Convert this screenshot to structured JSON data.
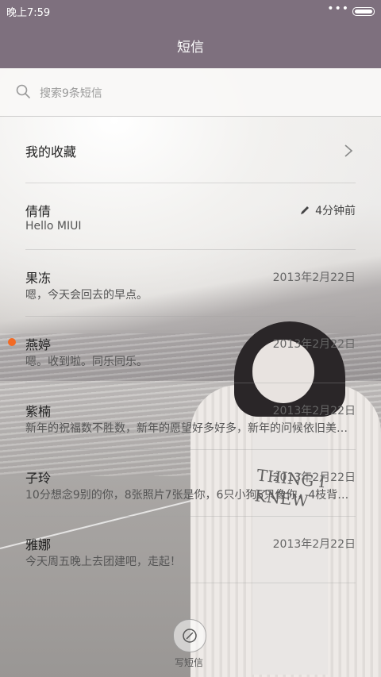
{
  "status_bar": {
    "time": "晚上7:59",
    "dots": "•••"
  },
  "header": {
    "title": "短信"
  },
  "search": {
    "placeholder": "搜索9条短信"
  },
  "favorites": {
    "label": "我的收藏"
  },
  "conversations": [
    {
      "name": "倩倩",
      "preview": "Hello MIUI",
      "meta": "4分钟前",
      "draft": true,
      "unread": false
    },
    {
      "name": "果冻",
      "preview": "嗯，今天会回去的早点。",
      "meta": "2013年2月22日",
      "draft": false,
      "unread": false
    },
    {
      "name": "燕婷",
      "preview": "嗯。收到啦。同乐同乐。",
      "meta": "2013年2月22日",
      "draft": false,
      "unread": true
    },
    {
      "name": "紫楠",
      "preview": "新年的祝福数不胜数，新年的愿望好多好多，新年的问候依旧美…",
      "meta": "2013年2月22日",
      "draft": false,
      "unread": false
    },
    {
      "name": "子玲",
      "preview": "10分想念9别的你，8张照片7张是你，6只小狗5只像你，4枝背…",
      "meta": "2013年2月22日",
      "draft": false,
      "unread": false
    },
    {
      "name": "雅娜",
      "preview": "今天周五晚上去团建吧，走起！",
      "meta": "2013年2月22日",
      "draft": false,
      "unread": false
    }
  ],
  "wallpaper_text": [
    "THING I",
    "KNEW"
  ],
  "compose": {
    "label": "写短信"
  },
  "colors": {
    "header_bg": "#7e707e",
    "unread_dot": "#f26a24"
  }
}
